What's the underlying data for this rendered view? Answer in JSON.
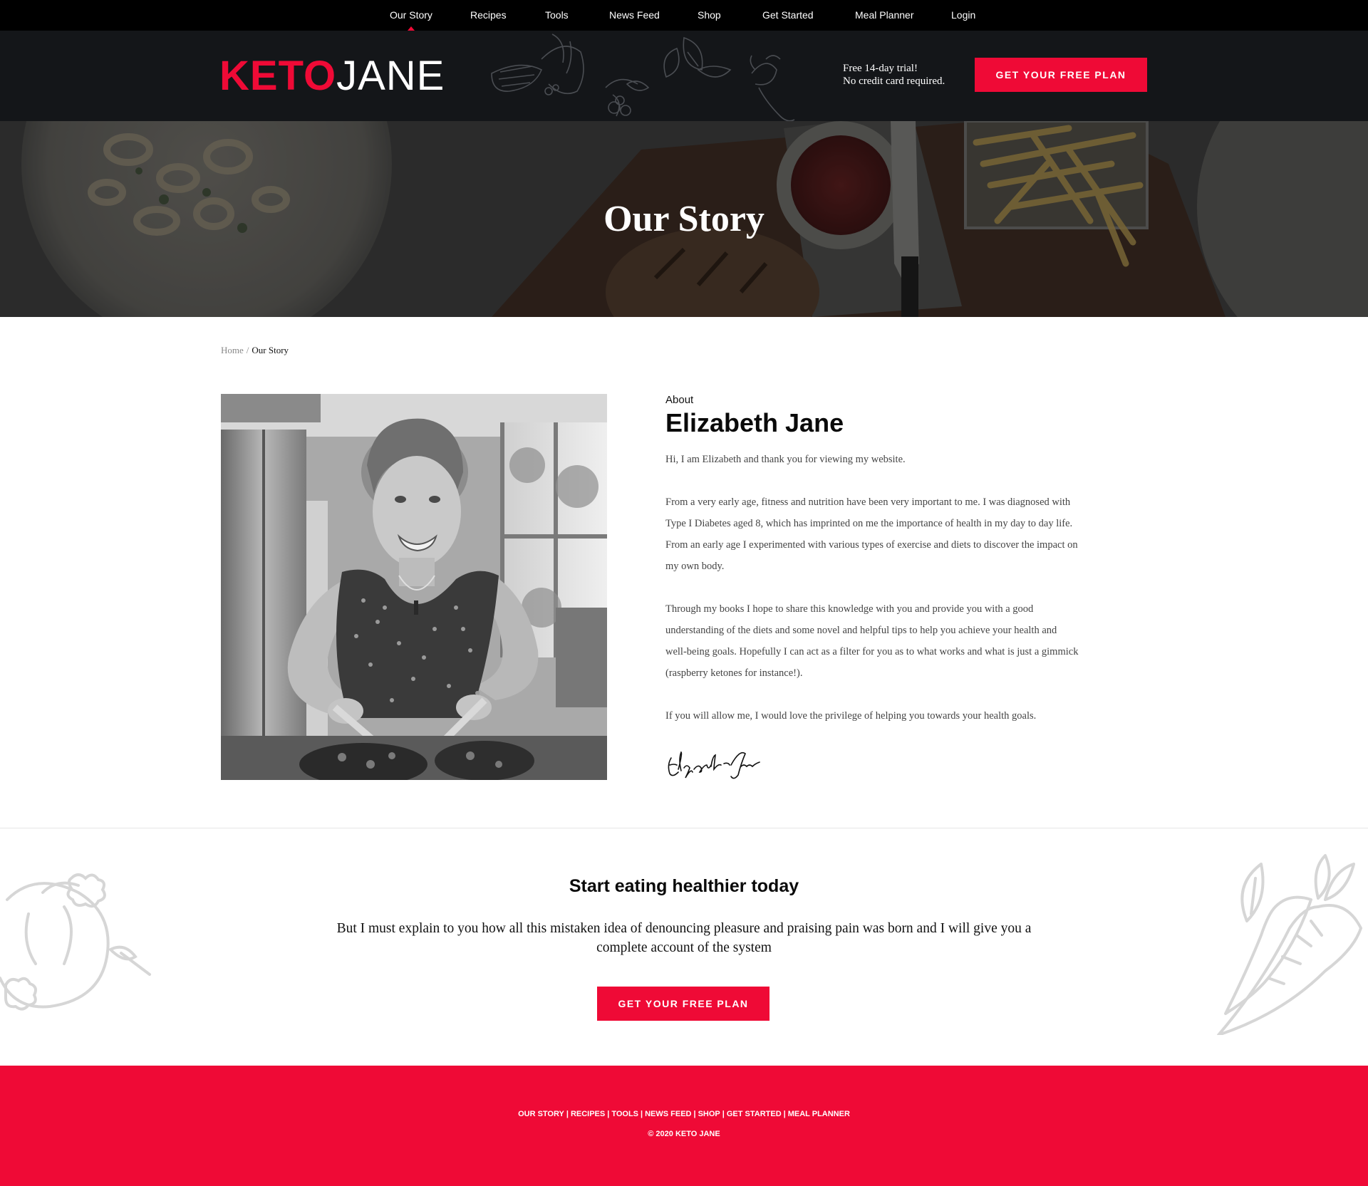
{
  "nav": {
    "items": [
      {
        "label": "Our Story",
        "active": true
      },
      {
        "label": "Recipes"
      },
      {
        "label": "Tools"
      },
      {
        "label": "News Feed"
      },
      {
        "label": "Shop"
      },
      {
        "label": "Get Started"
      },
      {
        "label": "Meal Planner"
      },
      {
        "label": "Login"
      }
    ]
  },
  "header": {
    "logo": {
      "part1": "KETO",
      "part2": "JANE"
    },
    "trial_line1": "Free 14-day trial!",
    "trial_line2": "No credit card required.",
    "cta_label": "GET YOUR FREE PLAN"
  },
  "hero": {
    "title": "Our Story"
  },
  "breadcrumb": {
    "home": "Home",
    "separator": "/",
    "current": "Our Story"
  },
  "about": {
    "eyebrow": "About",
    "name": "Elizabeth Jane",
    "paragraphs": [
      "Hi, I am Elizabeth and thank you for viewing my website.",
      "From a very early age, fitness and nutrition have been very important to me. I was diagnosed with Type I Diabetes aged 8, which has imprinted on me the importance of health in my day to day life. From an early age I experimented with various types of exercise and diets to discover the impact on my own body.",
      "Through my books I hope to share this knowledge with you and provide you with a good understanding of the diets and some novel and helpful tips to help you achieve your health and well-being goals. Hopefully I can act as a filter for you as to what works and what is just a gimmick (raspberry ketones for instance!).",
      "If you will allow me, I would love the privilege of helping you towards your health goals."
    ],
    "signature": "Elizabeth Jane"
  },
  "cta": {
    "title": "Start eating healthier today",
    "text": "But I must explain to you how all this mistaken idea of denouncing pleasure and praising pain was born and I will give you a complete account of the system",
    "button_label": "GET YOUR FREE PLAN"
  },
  "footer": {
    "links": [
      "OUR STORY",
      "RECIPES",
      "TOOLS",
      "NEWS FEED",
      "SHOP",
      "GET STARTED",
      "MEAL PLANNER"
    ],
    "copyright": "© 2020 KETO JANE"
  },
  "colors": {
    "brand_red": "#ef0a36",
    "nav_bg": "#000000",
    "header_bg": "#141619"
  },
  "icons": {
    "header_decor": "vegetable-doodles",
    "cta_left_decor": "fruit-doodle",
    "cta_right_decor": "carrot-doodle"
  }
}
